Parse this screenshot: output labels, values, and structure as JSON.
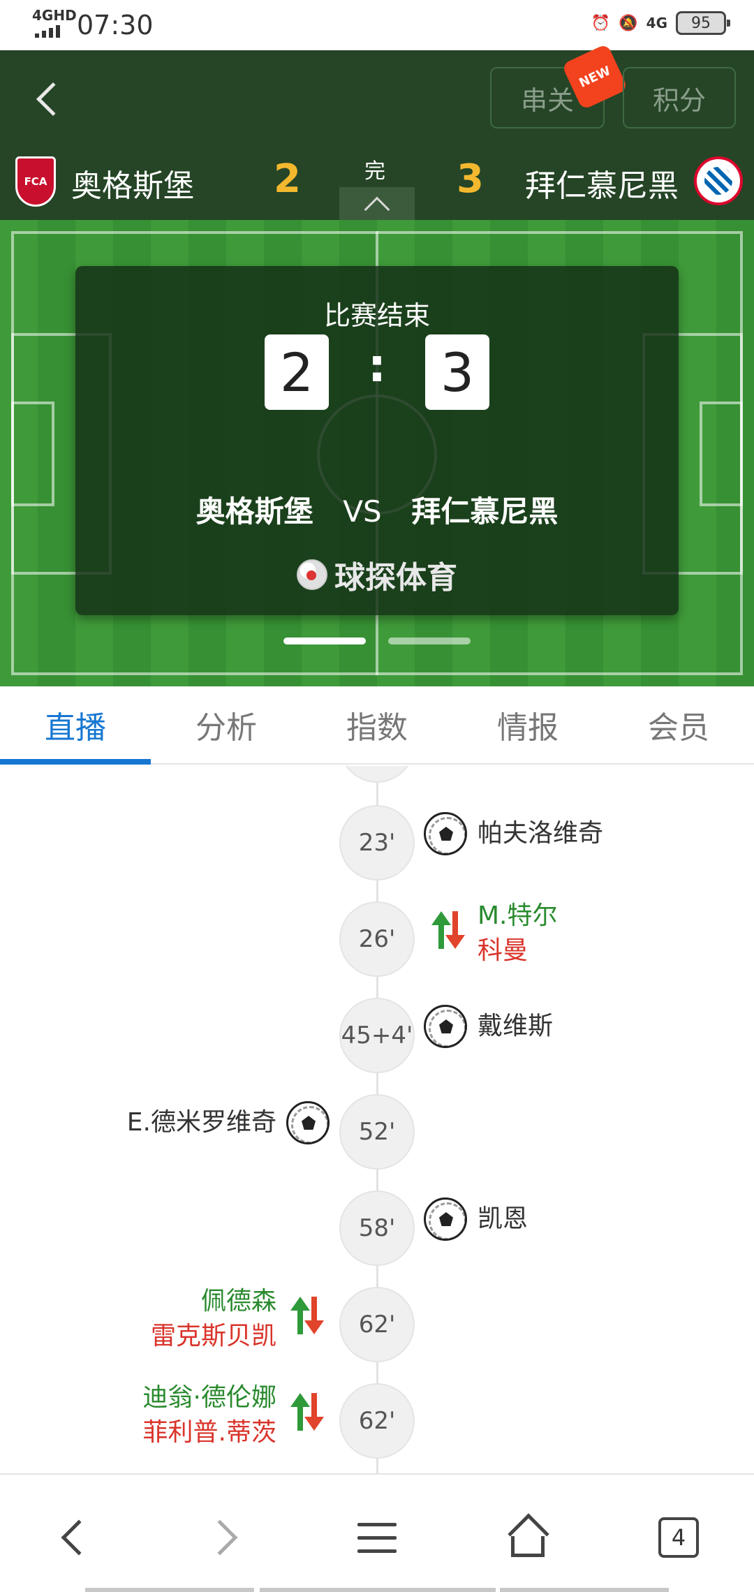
{
  "status_bar": {
    "network": "4GHD",
    "time": "07:30",
    "network_right": "4G",
    "battery": "95"
  },
  "header": {
    "chuan_label": "串关",
    "new_badge": "NEW",
    "jifen_label": "积分",
    "home_team": "奥格斯堡",
    "home_score": "2",
    "match_status": "完",
    "away_score": "3",
    "away_team": "拜仁慕尼黑",
    "home_logo_text": "FCA"
  },
  "card": {
    "title": "比赛结束",
    "home_score": "2",
    "colon": ":",
    "away_score": "3",
    "home_team": "奥格斯堡",
    "vs": "VS",
    "away_team": "拜仁慕尼黑",
    "brand": "球探体育"
  },
  "tabs": [
    {
      "label": "直播",
      "active": true
    },
    {
      "label": "分析",
      "active": false
    },
    {
      "label": "指数",
      "active": false
    },
    {
      "label": "情报",
      "active": false
    },
    {
      "label": "会员",
      "active": false
    }
  ],
  "events": [
    {
      "minute": "23'",
      "side": "away",
      "type": "goal",
      "player": "帕夫洛维奇"
    },
    {
      "minute": "26'",
      "side": "away",
      "type": "substitution",
      "player_in": "M.特尔",
      "player_out": "科曼"
    },
    {
      "minute": "45+4'",
      "side": "away",
      "type": "goal",
      "player": "戴维斯"
    },
    {
      "minute": "52'",
      "side": "home",
      "type": "goal",
      "player": "E.德米罗维奇"
    },
    {
      "minute": "58'",
      "side": "away",
      "type": "goal",
      "player": "凯恩"
    },
    {
      "minute": "62'",
      "side": "home",
      "type": "substitution",
      "player_in": "佩德森",
      "player_out": "雷克斯贝凯"
    },
    {
      "minute": "62'",
      "side": "home",
      "type": "substitution",
      "player_in": "迪翁·德伦娜",
      "player_out": "菲利普.蒂茨"
    }
  ],
  "bottom_nav": {
    "tab_count": "4"
  },
  "colors": {
    "header_bg": "#254526",
    "score_gold": "#f4b82f",
    "tab_active": "#1677d2",
    "sub_in_green": "#2a8a2e",
    "sub_out_red": "#d9342b"
  }
}
